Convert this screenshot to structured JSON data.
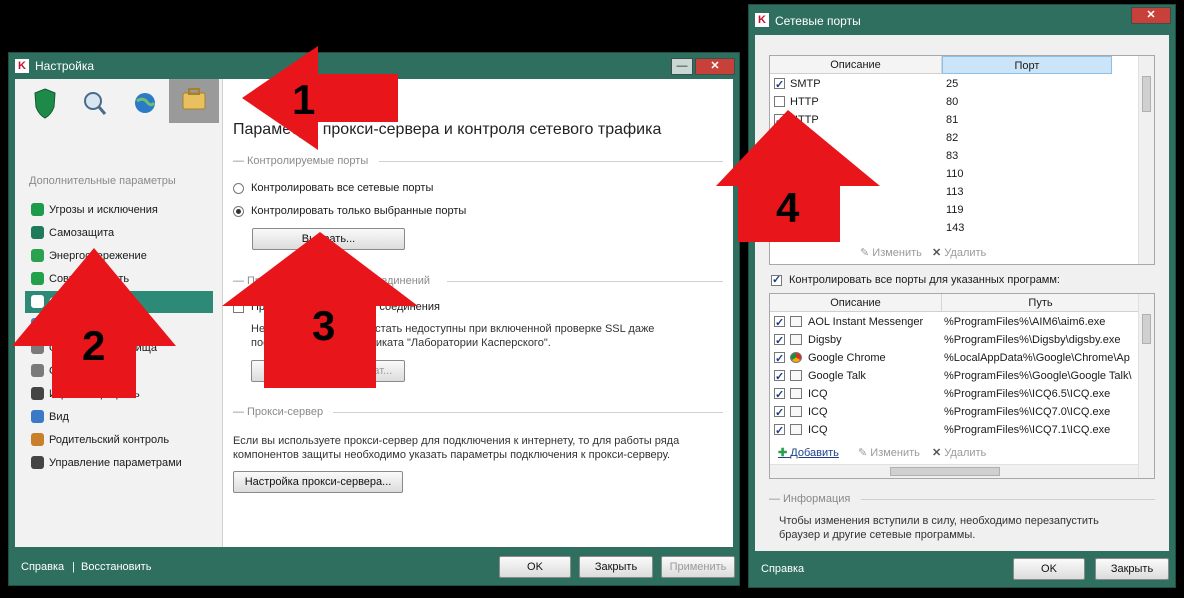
{
  "settings_window": {
    "title": "Настройка",
    "sidebar_heading": "Дополнительные параметры",
    "sidebar_items": [
      {
        "label": "Угрозы и исключения",
        "color": "#1e9a4b"
      },
      {
        "label": "Самозащита",
        "color": "#1e7a5a"
      },
      {
        "label": "Энергосбережение",
        "color": "#2aa14f"
      },
      {
        "label": "Совместимость",
        "color": "#23a04a"
      },
      {
        "label": "Сеть",
        "color": "#ffffff"
      },
      {
        "label": "Уведомления",
        "color": "#2a8ad8"
      },
      {
        "label": "Отчеты и хранилища",
        "color": "#7a7a7a"
      },
      {
        "label": "Обратная связь",
        "color": "#7a7a7a"
      },
      {
        "label": "Игровой профиль",
        "color": "#444444"
      },
      {
        "label": "Вид",
        "color": "#3a78c8"
      },
      {
        "label": "Родительский контроль",
        "color": "#c8802a"
      },
      {
        "label": "Управление параметрами",
        "color": "#444444"
      }
    ],
    "panel_title": "Параметры прокси-сервера и контроля сетевого трафика",
    "section_ports": "Контролируемые порты",
    "radio_all": "Контролировать все сетевые порты",
    "radio_selected": "Контролировать только выбранные порты",
    "select_button": "Выбрать...",
    "section_ssl": "Проверка защищенных соединений",
    "ssl_checkbox": "Проверять защищенные соединения",
    "ssl_note_1": "Некоторые сайты могут стать недоступны при включенной проверке SSL даже",
    "ssl_note_2": "после установки сертификата \"Лаборатории Касперского\".",
    "cert_button": "Установить сертификат...",
    "section_proxy": "Прокси-сервер",
    "proxy_note_1": "Если вы используете прокси-сервер для подключения к интернету, то для работы ряда",
    "proxy_note_2": "компонентов защиты необходимо указать параметры подключения к прокси-серверу.",
    "proxy_button": "Настройка прокси-сервера...",
    "footer_help": "Справка",
    "footer_restore": "Восстановить",
    "ok": "OK",
    "close": "Закрыть",
    "apply": "Применить"
  },
  "ports_window": {
    "title": "Сетевые порты",
    "col_desc": "Описание",
    "col_port": "Порт",
    "ports": [
      {
        "desc": "SMTP",
        "port": "25",
        "checked": true
      },
      {
        "desc": "HTTP",
        "port": "80",
        "checked": false
      },
      {
        "desc": "HTTP",
        "port": "81",
        "checked": true
      },
      {
        "desc": "",
        "port": "82",
        "checked": true
      },
      {
        "desc": "",
        "port": "83",
        "checked": true
      },
      {
        "desc": "",
        "port": "110",
        "checked": true
      },
      {
        "desc": "",
        "port": "113",
        "checked": true
      },
      {
        "desc": "",
        "port": "119",
        "checked": true
      },
      {
        "desc": "",
        "port": "143",
        "checked": true
      }
    ],
    "add": "Добавить",
    "edit": "Изменить",
    "delete": "Удалить",
    "all_ports_checkbox": "Контролировать все порты для указанных программ:",
    "col_path": "Путь",
    "apps": [
      {
        "name": "AOL Instant Messenger",
        "path": "%ProgramFiles%\\AIM6\\aim6.exe"
      },
      {
        "name": "Digsby",
        "path": "%ProgramFiles%\\Digsby\\digsby.exe"
      },
      {
        "name": "Google Chrome",
        "path": "%LocalAppData%\\Google\\Chrome\\Ap"
      },
      {
        "name": "Google Talk",
        "path": "%ProgramFiles%\\Google\\Google Talk\\"
      },
      {
        "name": "ICQ",
        "path": "%ProgramFiles%\\ICQ6.5\\ICQ.exe"
      },
      {
        "name": "ICQ",
        "path": "%ProgramFiles%\\ICQ7.0\\ICQ.exe"
      },
      {
        "name": "ICQ",
        "path": "%ProgramFiles%\\ICQ7.1\\ICQ.exe"
      }
    ],
    "info_heading": "Информация",
    "info_1": "Чтобы изменения вступили в силу, необходимо перезапустить",
    "info_2": "браузер и другие сетевые программы.",
    "footer_help": "Справка",
    "ok": "OK",
    "close": "Закрыть"
  },
  "annotations": [
    "1",
    "2",
    "3",
    "4"
  ],
  "colors": {
    "frame": "#2f6f60",
    "arrow": "#e8151b",
    "active_item": "#2d8a77"
  }
}
